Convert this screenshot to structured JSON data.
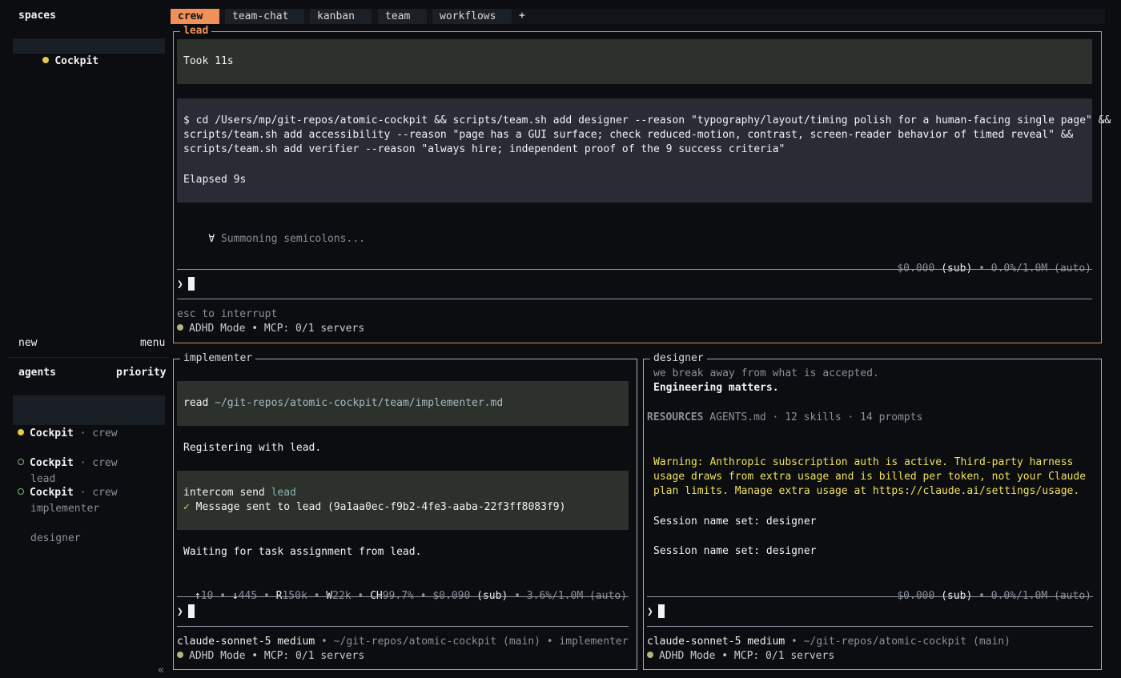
{
  "sidebar": {
    "spaces_header": "spaces",
    "spaces": [
      {
        "name": "Cockpit"
      }
    ],
    "new_label": "new",
    "menu_label": "menu",
    "agents_header": "agents",
    "priority_label": "priority",
    "agents": [
      {
        "name": "Cockpit",
        "space": "· crew",
        "role": "lead"
      },
      {
        "name": "Cockpit",
        "space": "· crew",
        "role": "implementer"
      },
      {
        "name": "Cockpit",
        "space": "· crew",
        "role": "designer"
      }
    ],
    "collapse_glyph": "«"
  },
  "tabs": [
    {
      "label": "crew"
    },
    {
      "label": "team-chat"
    },
    {
      "label": "kanban"
    },
    {
      "label": "team"
    },
    {
      "label": "workflows"
    }
  ],
  "tab_add": "+",
  "lead": {
    "title": "lead",
    "took": "Took 11s",
    "cmd_lines": [
      "$ cd /Users/mp/git-repos/atomic-cockpit && scripts/team.sh add designer --reason \"typography/layout/timing polish for a human-facing single page\" &&",
      "scripts/team.sh add accessibility --reason \"page has a GUI surface; check reduced-motion, contrast, screen-reader behavior of timed reveal\" &&",
      "scripts/team.sh add verifier --reason \"always hire; independent proof of the 9 success criteria\""
    ],
    "elapsed": "Elapsed 9s",
    "spinner_glyph": "∀",
    "spinner_text": "Summoning semicolons...",
    "cost": "$0.000",
    "sub": "(sub)",
    "usage": "• 0.0%/1.0M (auto)",
    "prompt": "❯",
    "interrupt": "esc to interrupt",
    "mode": "ADHD Mode • MCP: 0/1 servers"
  },
  "implementer": {
    "title": "implementer",
    "read_cmd": "read",
    "read_path": "~/git-repos/atomic-cockpit/team/implementer.md",
    "registering": "Registering with lead.",
    "intercom_cmd": "intercom send",
    "intercom_target": "lead",
    "check": "✓",
    "sent": "Message sent to lead (9a1aa0ec-f9b2-4fe3-aaba-22f3ff8083f9)",
    "waiting": "Waiting for task assignment from lead.",
    "stats": {
      "up_arrow": "↑",
      "up": "10",
      "down_arrow": "↓",
      "down": "445",
      "r_label": "R",
      "r": "150k",
      "w_label": "W",
      "w": "22k",
      "ch_label": "CH",
      "ch": "99.7%",
      "cost": "$0.090",
      "sub": "(sub)",
      "usage": "• 3.6%/1.0M (auto)"
    },
    "prompt": "❯",
    "model": "claude-sonnet-5 medium",
    "path": "• ~/git-repos/atomic-cockpit (main) • implementer",
    "mode": "ADHD Mode • MCP: 0/1 servers"
  },
  "designer": {
    "title": "designer",
    "tagline": "we break away from what is accepted.",
    "engineering": "Engineering matters.",
    "resources_label": "RESOURCES",
    "resources": "AGENTS.md · 12 skills · 14 prompts",
    "warning_lines": [
      "Warning: Anthropic subscription auth is active. Third-party harness",
      "usage draws from extra usage and is billed per token, not your Claude",
      "plan limits. Manage extra usage at https://claude.ai/settings/usage."
    ],
    "session1": "Session name set: designer",
    "session2": "Session name set: designer",
    "cost": "$0.000",
    "sub": "(sub)",
    "usage": "• 0.0%/1.0M (auto)",
    "prompt": "❯",
    "model": "claude-sonnet-5 medium",
    "path": "• ~/git-repos/atomic-cockpit (main)",
    "mode": "ADHD Mode • MCP: 0/1 servers"
  },
  "colors": {
    "accent": "#f0915a",
    "pane_border": "#9fb0c0",
    "warning": "#f2e05a",
    "status_dot": "#e8c94a"
  }
}
